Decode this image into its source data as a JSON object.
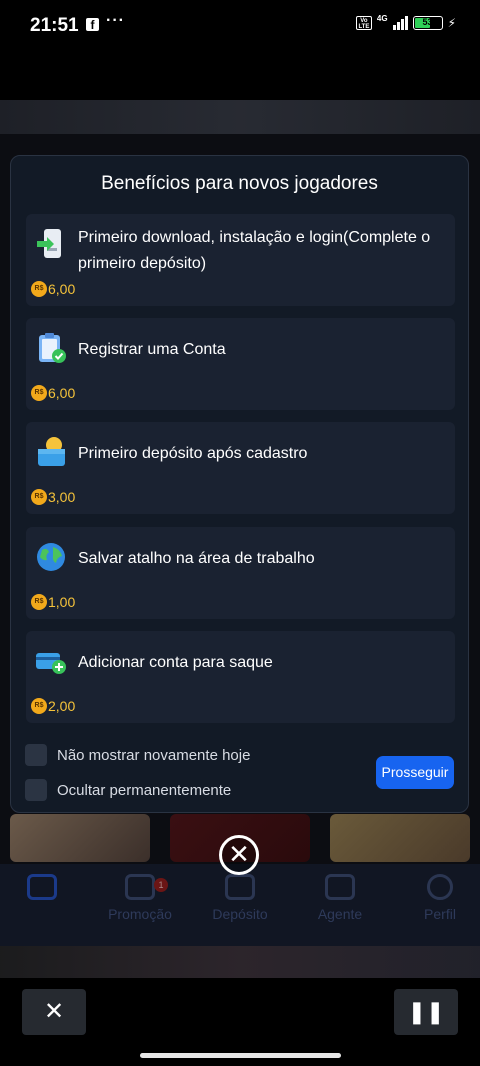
{
  "status_bar": {
    "time": "21:51",
    "network": "4G",
    "volte": "Vo LTE",
    "battery": "53"
  },
  "background_nav": {
    "items": [
      {
        "label": "Promoção",
        "badge": "1"
      },
      {
        "label": "Depósito",
        "badge": ""
      },
      {
        "label": "Agente",
        "badge": ""
      },
      {
        "label": "Perfil",
        "badge": ""
      }
    ]
  },
  "modal": {
    "title": "Benefícios para novos jogadores",
    "currency_symbol": "R$",
    "tasks": [
      {
        "label": "Primeiro download, instalação e login(Complete o primeiro depósito)",
        "reward": "6,00",
        "icon": "phone-download-icon"
      },
      {
        "label": "Registrar uma Conta",
        "reward": "6,00",
        "icon": "clipboard-check-icon"
      },
      {
        "label": "Primeiro depósito após cadastro",
        "reward": "3,00",
        "icon": "wallet-coin-icon"
      },
      {
        "label": "Salvar atalho na área de trabalho",
        "reward": "1,00",
        "icon": "globe-icon"
      },
      {
        "label": "Adicionar conta para saque",
        "reward": "2,00",
        "icon": "card-add-icon"
      }
    ],
    "checkbox_today": "Não mostrar novamente hoje",
    "checkbox_permanent": "Ocultar permanentemente",
    "proceed_label": "Prosseguir"
  },
  "colors": {
    "accent": "#1764f0",
    "reward": "#f5c33b",
    "modal_bg": "#121a26",
    "card_bg": "#1a2231"
  },
  "bottom_controls": {
    "close_icon": "close-icon",
    "pause_icon": "pause-icon"
  }
}
